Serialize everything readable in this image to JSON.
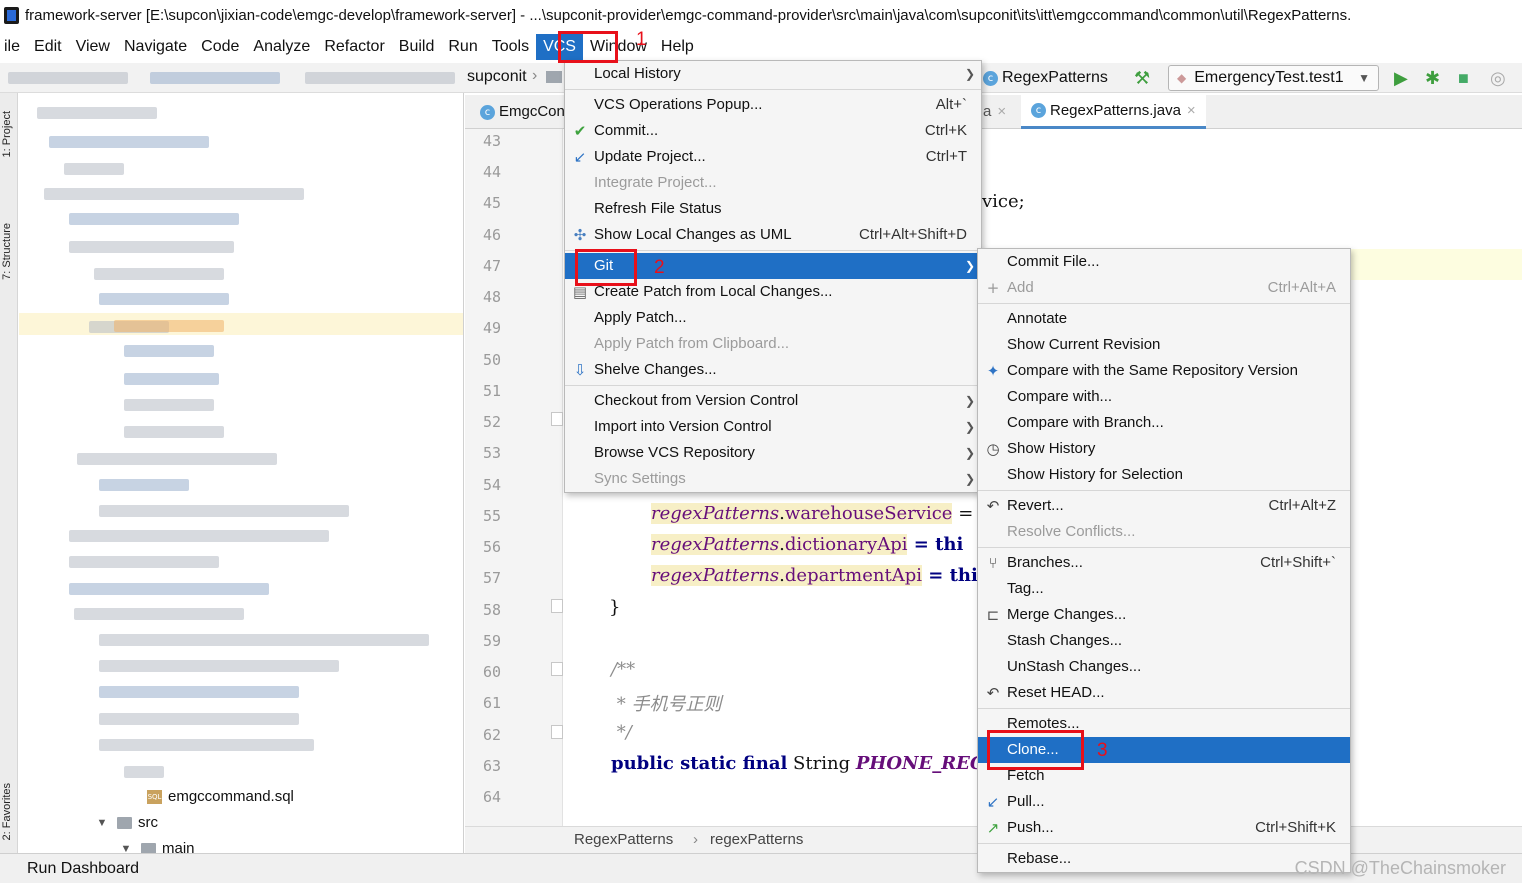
{
  "window": {
    "title": "framework-server [E:\\supcon\\jixian-code\\emgc-develop\\framework-server] - ...\\supconit-provider\\emgc-command-provider\\src\\main\\java\\com\\supconit\\its\\itt\\emgccommand\\common\\util\\RegexPatterns."
  },
  "menubar": [
    "ile",
    "Edit",
    "View",
    "Navigate",
    "Code",
    "Analyze",
    "Refactor",
    "Build",
    "Run",
    "Tools",
    "VCS",
    "Window",
    "Help"
  ],
  "toolbar": {
    "breadcrumb_project": "supconit",
    "class_name": "RegexPatterns",
    "run_config": "EmergencyTest.test1"
  },
  "tool_windows": {
    "project": "1: Project",
    "structure": "7: Structure",
    "favorites": "2: Favorites"
  },
  "project_tree": {
    "sql_file": "emgccommand.sql",
    "src": "src",
    "main": "main"
  },
  "editor": {
    "tabs": [
      "EmgcCon",
      "a",
      "RegexPatterns.java"
    ],
    "line_numbers": [
      "43",
      "44",
      "45",
      "46",
      "47",
      "48",
      "49",
      "50",
      "51",
      "52",
      "53",
      "54",
      "55",
      "56",
      "57",
      "58",
      "59",
      "60",
      "61",
      "62",
      "63",
      "64"
    ],
    "code": {
      "line45_tail": "vice;",
      "line55_obj": "regexPatterns",
      "line55_field": "warehouseService",
      "line55_tail": " =",
      "line56_obj": "regexPatterns",
      "line56_field": "dictionaryApi",
      "line56_tail": " = thi",
      "line57_obj": "regexPatterns",
      "line57_field": "departmentApi",
      "line57_tail": " = thi",
      "line58": "}",
      "line60": "/**",
      "line61": " * 手机号正则",
      "line62": " */",
      "line63_kw": "public static final",
      "line63_type": " String ",
      "line63_const": "PHONE_REGE"
    },
    "breadcrumb": [
      "RegexPatterns",
      "regexPatterns"
    ]
  },
  "vcs_menu": {
    "items": [
      {
        "label": "Local History",
        "shortcut": "",
        "submenu": true,
        "disabled": false,
        "icon": ""
      },
      {
        "sep": true
      },
      {
        "label": "VCS Operations Popup...",
        "shortcut": "Alt+`",
        "submenu": false,
        "disabled": false,
        "icon": ""
      },
      {
        "label": "Commit...",
        "shortcut": "Ctrl+K",
        "submenu": false,
        "disabled": false,
        "icon": "check-icon"
      },
      {
        "label": "Update Project...",
        "shortcut": "Ctrl+T",
        "submenu": false,
        "disabled": false,
        "icon": "update-icon"
      },
      {
        "label": "Integrate Project...",
        "shortcut": "",
        "submenu": false,
        "disabled": true,
        "icon": ""
      },
      {
        "label": "Refresh File Status",
        "shortcut": "",
        "submenu": false,
        "disabled": false,
        "icon": ""
      },
      {
        "label": "Show Local Changes as UML",
        "shortcut": "Ctrl+Alt+Shift+D",
        "submenu": false,
        "disabled": false,
        "icon": "uml-icon"
      },
      {
        "sep": true
      },
      {
        "label": "Git",
        "shortcut": "",
        "submenu": true,
        "disabled": false,
        "icon": "",
        "selected": true
      },
      {
        "label": "Create Patch from Local Changes...",
        "shortcut": "",
        "submenu": false,
        "disabled": false,
        "icon": "patch-icon"
      },
      {
        "label": "Apply Patch...",
        "shortcut": "",
        "submenu": false,
        "disabled": false,
        "icon": ""
      },
      {
        "label": "Apply Patch from Clipboard...",
        "shortcut": "",
        "submenu": false,
        "disabled": true,
        "icon": ""
      },
      {
        "label": "Shelve Changes...",
        "shortcut": "",
        "submenu": false,
        "disabled": false,
        "icon": "shelve-icon"
      },
      {
        "sep": true
      },
      {
        "label": "Checkout from Version Control",
        "shortcut": "",
        "submenu": true,
        "disabled": false,
        "icon": ""
      },
      {
        "label": "Import into Version Control",
        "shortcut": "",
        "submenu": true,
        "disabled": false,
        "icon": ""
      },
      {
        "label": "Browse VCS Repository",
        "shortcut": "",
        "submenu": true,
        "disabled": false,
        "icon": ""
      },
      {
        "label": "Sync Settings",
        "shortcut": "",
        "submenu": true,
        "disabled": true,
        "icon": ""
      }
    ]
  },
  "git_menu": {
    "items": [
      {
        "label": "Commit File...",
        "shortcut": "",
        "disabled": false,
        "icon": ""
      },
      {
        "label": "Add",
        "shortcut": "Ctrl+Alt+A",
        "disabled": true,
        "icon": "plus-icon"
      },
      {
        "sep": true
      },
      {
        "label": "Annotate",
        "shortcut": "",
        "disabled": false,
        "icon": ""
      },
      {
        "label": "Show Current Revision",
        "shortcut": "",
        "disabled": false,
        "icon": ""
      },
      {
        "label": "Compare with the Same Repository Version",
        "shortcut": "",
        "disabled": false,
        "icon": "compare-icon"
      },
      {
        "label": "Compare with...",
        "shortcut": "",
        "disabled": false,
        "icon": ""
      },
      {
        "label": "Compare with Branch...",
        "shortcut": "",
        "disabled": false,
        "icon": ""
      },
      {
        "label": "Show History",
        "shortcut": "",
        "disabled": false,
        "icon": "clock-icon"
      },
      {
        "label": "Show History for Selection",
        "shortcut": "",
        "disabled": false,
        "icon": ""
      },
      {
        "sep": true
      },
      {
        "label": "Revert...",
        "shortcut": "Ctrl+Alt+Z",
        "disabled": false,
        "icon": "revert-icon"
      },
      {
        "label": "Resolve Conflicts...",
        "shortcut": "",
        "disabled": true,
        "icon": ""
      },
      {
        "sep": true
      },
      {
        "label": "Branches...",
        "shortcut": "Ctrl+Shift+`",
        "disabled": false,
        "icon": "branch-icon"
      },
      {
        "label": "Tag...",
        "shortcut": "",
        "disabled": false,
        "icon": ""
      },
      {
        "label": "Merge Changes...",
        "shortcut": "",
        "disabled": false,
        "icon": "merge-icon"
      },
      {
        "label": "Stash Changes...",
        "shortcut": "",
        "disabled": false,
        "icon": ""
      },
      {
        "label": "UnStash Changes...",
        "shortcut": "",
        "disabled": false,
        "icon": ""
      },
      {
        "label": "Reset HEAD...",
        "shortcut": "",
        "disabled": false,
        "icon": "reset-icon"
      },
      {
        "sep": true
      },
      {
        "label": "Remotes...",
        "shortcut": "",
        "disabled": false,
        "icon": ""
      },
      {
        "label": "Clone...",
        "shortcut": "",
        "disabled": false,
        "icon": "",
        "selected": true
      },
      {
        "label": "Fetch",
        "shortcut": "",
        "disabled": false,
        "icon": ""
      },
      {
        "label": "Pull...",
        "shortcut": "",
        "disabled": false,
        "icon": "pull-icon"
      },
      {
        "label": "Push...",
        "shortcut": "Ctrl+Shift+K",
        "disabled": false,
        "icon": "push-icon"
      },
      {
        "sep": true
      },
      {
        "label": "Rebase...",
        "shortcut": "",
        "disabled": false,
        "icon": ""
      }
    ]
  },
  "annotations": [
    "1",
    "2",
    "3"
  ],
  "statusbar": {
    "run_dashboard": "Run Dashboard"
  },
  "watermark": "CSDN @TheChainsmoker",
  "colors": {
    "selection": "#1f6fc5",
    "annotation_red": "#e8101a"
  }
}
